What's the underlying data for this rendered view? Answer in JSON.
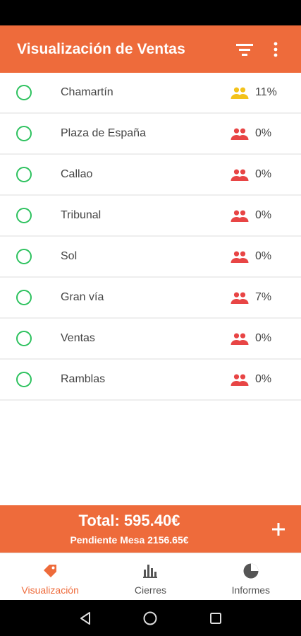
{
  "app_bar": {
    "title": "Visualización de Ventas",
    "filter_icon": "filter-icon",
    "more_icon": "more-vert-icon"
  },
  "locations": [
    {
      "name": "Chamartín",
      "percent": "11%",
      "status_color": "#f3c21b"
    },
    {
      "name": "Plaza de España",
      "percent": "0%",
      "status_color": "#e84545"
    },
    {
      "name": "Callao",
      "percent": "0%",
      "status_color": "#e84545"
    },
    {
      "name": "Tribunal",
      "percent": "0%",
      "status_color": "#e84545"
    },
    {
      "name": "Sol",
      "percent": "0%",
      "status_color": "#e84545"
    },
    {
      "name": "Gran vía",
      "percent": "7%",
      "status_color": "#e84545"
    },
    {
      "name": "Ventas",
      "percent": "0%",
      "status_color": "#e84545"
    },
    {
      "name": "Ramblas",
      "percent": "0%",
      "status_color": "#e84545"
    }
  ],
  "totals": {
    "total": "Total: 595.40€",
    "pending": "Pendiente Mesa 2156.65€"
  },
  "bottom_nav": {
    "items": [
      {
        "label": "Visualización",
        "icon": "tag-icon",
        "active": true
      },
      {
        "label": "Cierres",
        "icon": "bar-chart-icon",
        "active": false
      },
      {
        "label": "Informes",
        "icon": "pie-chart-icon",
        "active": false
      }
    ]
  },
  "colors": {
    "accent": "#ee6b3b",
    "radio": "#2ec25f",
    "warning": "#f3c21b",
    "danger": "#e84545"
  }
}
